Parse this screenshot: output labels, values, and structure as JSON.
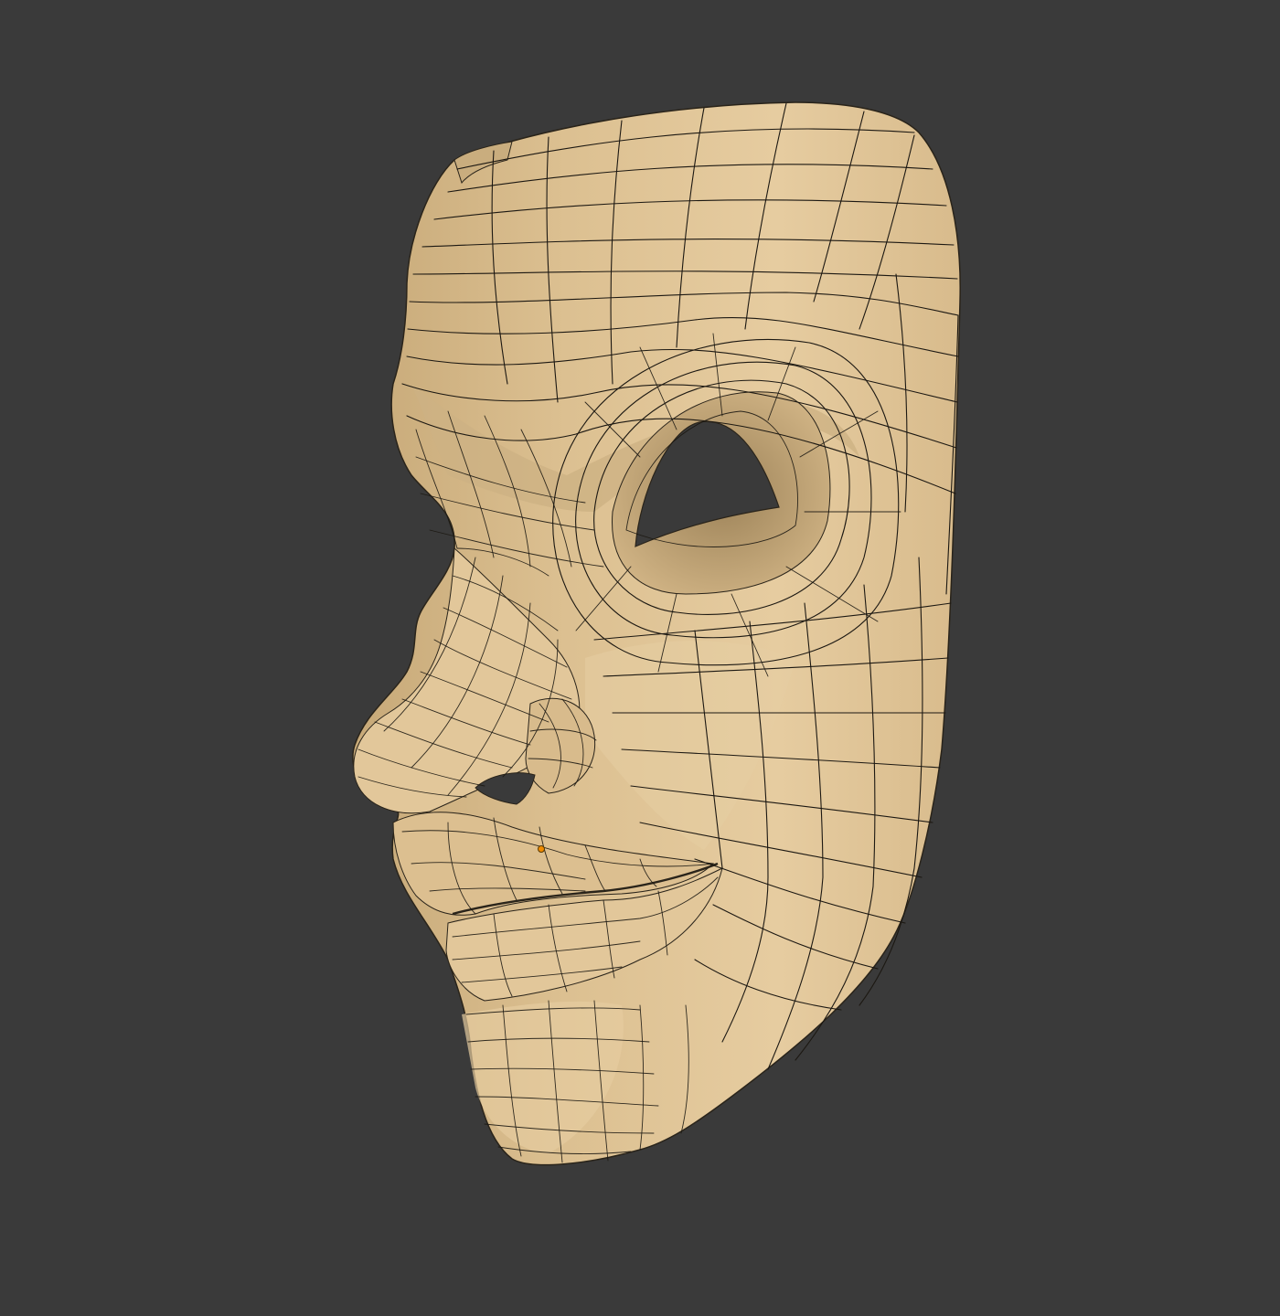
{
  "viewport": {
    "background_color": "#3a3a3a",
    "object": {
      "name": "mask",
      "material_color": "#e2c79a",
      "shadow_color": "#b89c6e",
      "wireframe_color": "#1c1812",
      "overlay": "wireframe"
    },
    "origin_marker": {
      "color": "#f08a00",
      "icon": "object-origin-dot"
    }
  }
}
